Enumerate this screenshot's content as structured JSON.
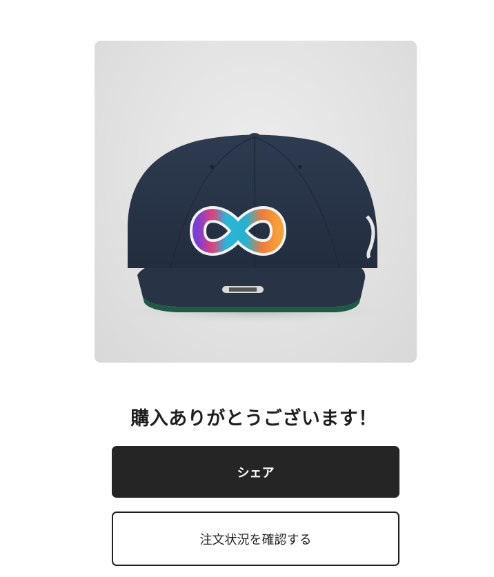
{
  "product": {
    "image_alt": "navy snapback cap with rainbow infinity logo"
  },
  "confirmation": {
    "headline": "購入ありがとうございます！"
  },
  "actions": {
    "share_label": "シェア",
    "order_status_label": "注文状況を確認する"
  },
  "colors": {
    "primary_button": "#252525",
    "background": "#ffffff",
    "text": "#1e1e1e"
  }
}
